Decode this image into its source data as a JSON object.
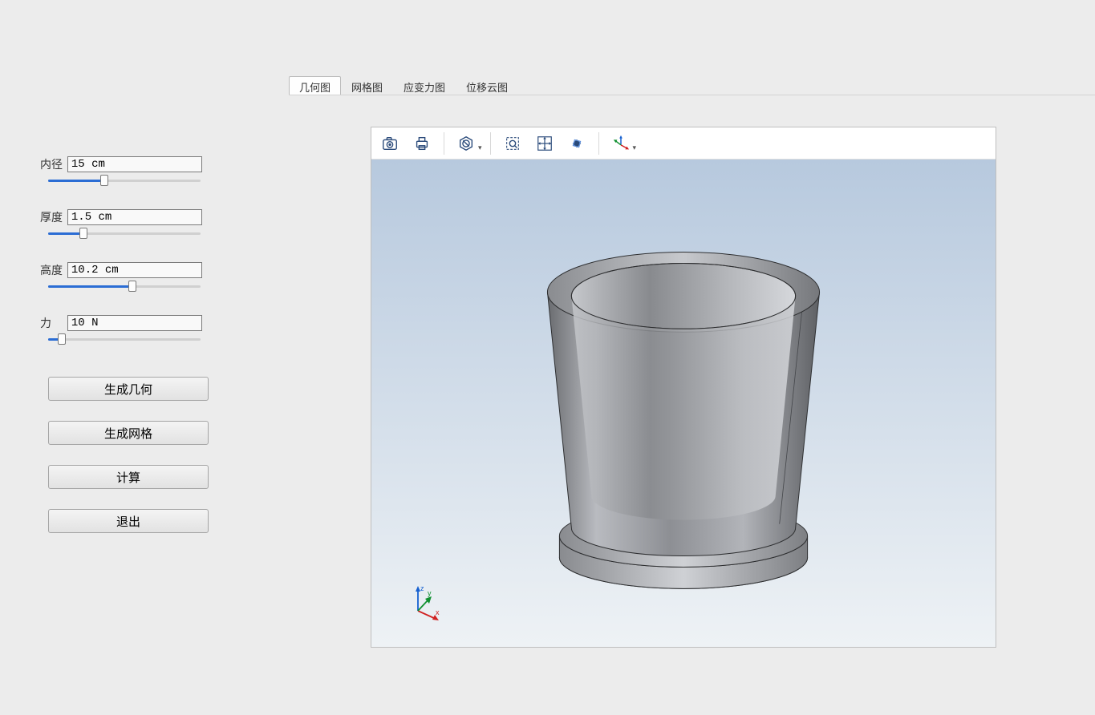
{
  "params": {
    "inner_diameter": {
      "label": "内径",
      "value": "15 cm",
      "slider_pct": 37
    },
    "thickness": {
      "label": "厚度",
      "value": "1.5 cm",
      "slider_pct": 23
    },
    "height": {
      "label": "高度",
      "value": "10.2 cm",
      "slider_pct": 55
    },
    "force": {
      "label": "力",
      "value": "10 N",
      "slider_pct": 9
    }
  },
  "buttons": {
    "gen_geometry": "生成几何",
    "gen_mesh": "生成网格",
    "compute": "计算",
    "exit": "退出"
  },
  "tabs": {
    "geometry": "几何图",
    "mesh": "网格图",
    "stress": "应变力图",
    "displacement": "位移云图",
    "active": "geometry"
  },
  "viewport_toolbar": {
    "snapshot": "camera-icon",
    "print": "print-icon",
    "reset": "reset-icon",
    "zoom_box": "zoom-box-icon",
    "pan": "pan-icon",
    "rotate": "rotate-icon",
    "axes": "axes-icon"
  },
  "axis_labels": {
    "x": "x",
    "y": "y",
    "z": "z"
  }
}
